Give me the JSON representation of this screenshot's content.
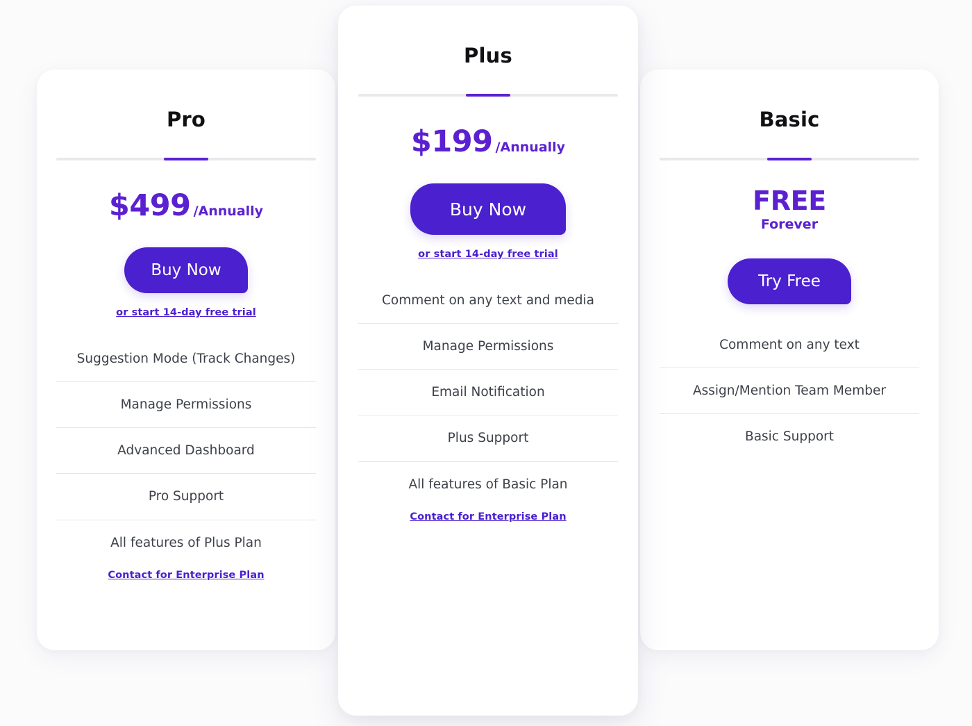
{
  "theme": {
    "page_background": "#fbfbfc",
    "card_background": "#ffffff",
    "accent_purple": "#5b21d0",
    "button_purple": "#4b20cf",
    "link_purple": "#4b20cf",
    "feature_text": "#3d4149",
    "title_text": "#111114",
    "divider": "#e7e7ea"
  },
  "plans": [
    {
      "id": "pro",
      "title": "Pro",
      "price_amount": "$499",
      "price_period": "/Annually",
      "cta_label": "Buy Now",
      "trial_link": "or start 14-day free trial",
      "features": [
        "Suggestion Mode (Track Changes)",
        "Manage Permissions",
        "Advanced Dashboard",
        "Pro Support",
        "All features of Plus Plan"
      ],
      "enterprise_link": "Contact for Enterprise Plan"
    },
    {
      "id": "plus",
      "title": "Plus",
      "price_amount": "$199",
      "price_period": "/Annually",
      "cta_label": "Buy Now",
      "trial_link": "or start 14-day free trial",
      "features": [
        "Comment on any text and media",
        "Manage Permissions",
        "Email Notification",
        "Plus Support",
        "All features of Basic Plan"
      ],
      "enterprise_link": "Contact for Enterprise Plan"
    },
    {
      "id": "basic",
      "title": "Basic",
      "price_free_main": "FREE",
      "price_free_sub": "Forever",
      "cta_label": "Try Free",
      "features": [
        "Comment on any text",
        "Assign/Mention Team Member",
        "Basic Support"
      ]
    }
  ]
}
